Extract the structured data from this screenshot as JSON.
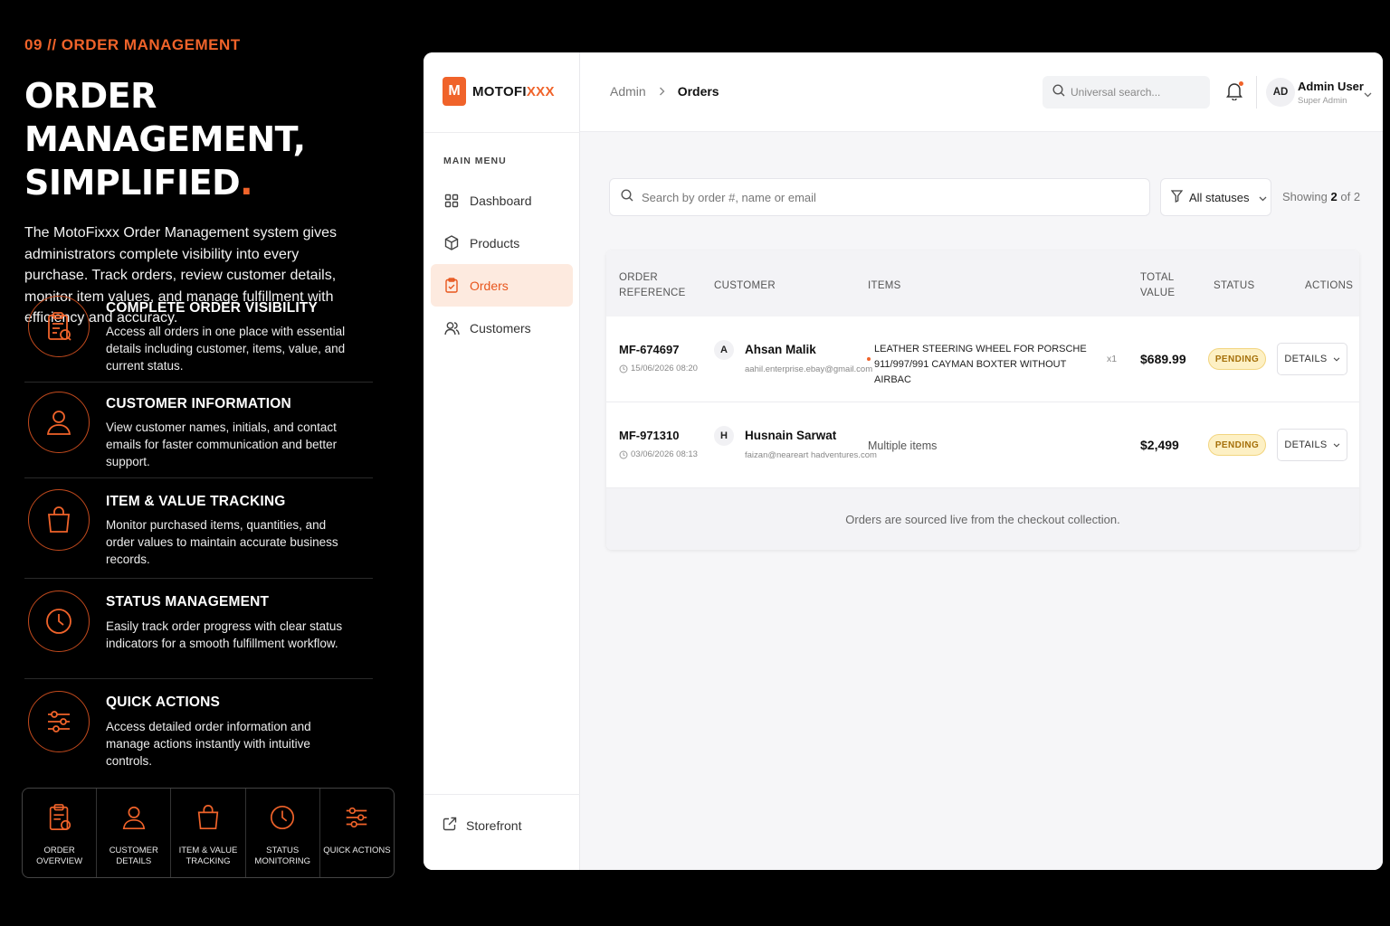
{
  "promo": {
    "kicker": "09 // ORDER MANAGEMENT",
    "headline_line1": "ORDER MANAGEMENT,",
    "headline_line2": "SIMPLIFIED",
    "headline_dot": ".",
    "intro": "The MotoFixxx Order Management system gives administrators complete visibility into every purchase. Track orders, review customer details, monitor item values, and manage fulfillment with efficiency and accuracy.",
    "accent_color": "#f0632a",
    "features": [
      {
        "icon": "clipboard-icon",
        "title": "COMPLETE ORDER VISIBILITY",
        "desc": "Access all orders in one place with essential details including customer, items, value, and current status."
      },
      {
        "icon": "user-icon",
        "title": "CUSTOMER INFORMATION",
        "desc": "View customer names, initials, and contact emails for faster communication and better support."
      },
      {
        "icon": "shopping-bag-icon",
        "title": "ITEM & VALUE TRACKING",
        "desc": "Monitor purchased items, quantities, and order values to maintain accurate business records."
      },
      {
        "icon": "clock-icon",
        "title": "STATUS MANAGEMENT",
        "desc": "Easily track order progress with clear status indicators for a smooth fulfillment workflow."
      },
      {
        "icon": "sliders-icon",
        "title": "QUICK ACTIONS",
        "desc": "Access detailed order information and manage actions instantly with intuitive controls."
      }
    ],
    "iconbar": [
      {
        "icon": "clipboard-icon",
        "label": "ORDER OVERVIEW"
      },
      {
        "icon": "user-icon",
        "label": "CUSTOMER DETAILS"
      },
      {
        "icon": "shopping-bag-icon",
        "label": "ITEM & VALUE TRACKING"
      },
      {
        "icon": "clock-icon",
        "label": "STATUS MONITORING"
      },
      {
        "icon": "sliders-icon",
        "label": "QUICK ACTIONS"
      }
    ]
  },
  "app": {
    "brand": {
      "logo_letter": "M",
      "name_prefix": "MOTOFI",
      "name_accent": "XXX"
    },
    "sidebar": {
      "menu_title": "MAIN MENU",
      "items": [
        {
          "icon": "grid-icon",
          "label": "Dashboard",
          "active": false
        },
        {
          "icon": "box-icon",
          "label": "Products",
          "active": false
        },
        {
          "icon": "clipboard-icon",
          "label": "Orders",
          "active": true
        },
        {
          "icon": "users-icon",
          "label": "Customers",
          "active": false
        }
      ],
      "storefront": {
        "icon": "external-link-icon",
        "label": "Storefront"
      }
    },
    "topbar": {
      "breadcrumb": [
        "Admin",
        "Orders"
      ],
      "search_placeholder": "Universal search...",
      "user": {
        "initials": "AD",
        "name": "Admin User",
        "role": "Super Admin"
      }
    },
    "orders": {
      "search_placeholder": "Search by order #, name or email",
      "status_filter": "All statuses",
      "showing_prefix": "Showing",
      "showing_count": "2",
      "showing_suffix": "of 2",
      "columns": {
        "ref_1": "ORDER",
        "ref_2": "REFERENCE",
        "customer": "CUSTOMER",
        "items": "ITEMS",
        "total_1": "TOTAL",
        "total_2": "VALUE",
        "status": "STATUS",
        "actions": "ACTIONS"
      },
      "rows": [
        {
          "ref": "MF-674697",
          "date": "15/06/2026 08:20",
          "initial": "A",
          "customer": "Ahsan Malik",
          "email": "aahil.enterprise.ebay@gmail.com",
          "items": "LEATHER STEERING WHEEL FOR PORSCHE 911/997/991 CAYMAN BOXTER WITHOUT AIRBAC",
          "qty": "x1",
          "total": "$689.99",
          "status": "PENDING",
          "action": "DETAILS"
        },
        {
          "ref": "MF-971310",
          "date": "03/06/2026 08:13",
          "initial": "H",
          "customer": "Husnain Sarwat",
          "email": "faizan@neareart hadventures.com",
          "items": "Multiple items",
          "total": "$2,499",
          "status": "PENDING",
          "action": "DETAILS"
        }
      ],
      "footer_note": "Orders are sourced live from the checkout collection."
    }
  }
}
